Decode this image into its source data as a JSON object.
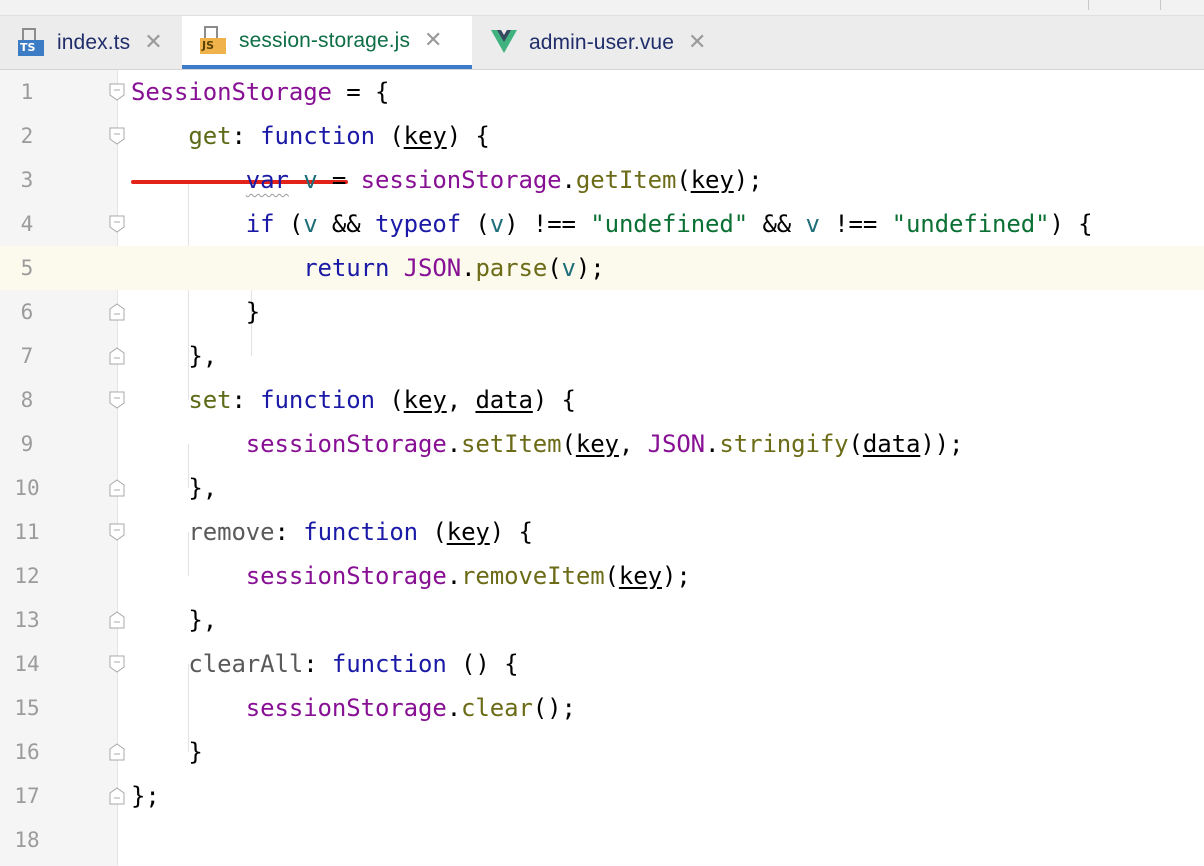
{
  "tabs": [
    {
      "label": "index.ts",
      "badge": "TS",
      "icon": "typescript-file-icon"
    },
    {
      "label": "session-storage.js",
      "badge": "JS",
      "icon": "javascript-file-icon",
      "active": true
    },
    {
      "label": "admin-user.vue",
      "icon": "vue-file-icon"
    }
  ],
  "close_glyph": "✕",
  "line_numbers": [
    "1",
    "2",
    "3",
    "4",
    "5",
    "6",
    "7",
    "8",
    "9",
    "10",
    "11",
    "12",
    "13",
    "14",
    "15",
    "16",
    "17",
    "18"
  ],
  "current_line": 5,
  "code": {
    "l1": {
      "obj": "SessionStorage",
      "rest": " = {"
    },
    "l2": {
      "prop": "get",
      "colon": ": ",
      "kw": "function",
      "sp": " (",
      "p1": "key",
      "end": ") {"
    },
    "l3": {
      "kw": "var",
      "sp": " ",
      "v": "v",
      "eq": " = ",
      "obj": "sessionStorage",
      "dot": ".",
      "m": "getItem",
      "open": "(",
      "p": "key",
      "close": ");"
    },
    "l4": {
      "kw": "if",
      "o1": " (",
      "v1": "v",
      "a1": " && ",
      "kw2": "typeof",
      "o2": " (",
      "v2": "v",
      "o3": ") !== ",
      "s1": "\"undefined\"",
      "a2": " && ",
      "v3": "v",
      "o4": " !== ",
      "s2": "\"undefined\"",
      "end": ") {"
    },
    "l5": {
      "kw": "return",
      "sp": " ",
      "obj": "JSON",
      "dot": ".",
      "m": "parse",
      "open": "(",
      "v": "v",
      "close": ");"
    },
    "l6": {
      "text": "}"
    },
    "l7": {
      "text": "},"
    },
    "l8": {
      "prop": "set",
      "colon": ": ",
      "kw": "function",
      "sp": " (",
      "p1": "key",
      "comma": ", ",
      "p2": "data",
      "end": ") {"
    },
    "l9": {
      "obj": "sessionStorage",
      "dot": ".",
      "m": "setItem",
      "open": "(",
      "p1": "key",
      "comma": ", ",
      "obj2": "JSON",
      "dot2": ".",
      "m2": "stringify",
      "open2": "(",
      "p2": "data",
      "close": "));"
    },
    "l10": {
      "text": "},"
    },
    "l11": {
      "prop": "remove",
      "colon": ": ",
      "kw": "function",
      "sp": " (",
      "p1": "key",
      "end": ") {"
    },
    "l12": {
      "obj": "sessionStorage",
      "dot": ".",
      "m": "removeItem",
      "open": "(",
      "p": "key",
      "close": ");"
    },
    "l13": {
      "text": "},"
    },
    "l14": {
      "prop": "clearAll",
      "colon": ": ",
      "kw": "function",
      "end": " () {"
    },
    "l15": {
      "obj": "sessionStorage",
      "dot": ".",
      "m": "clear",
      "close": "();"
    },
    "l16": {
      "text": "}"
    },
    "l17": {
      "text": "};"
    },
    "l18": {
      "text": ""
    }
  },
  "colors": {
    "keyword": "#1a1aa6",
    "global": "#871094",
    "property": "#5c6b17",
    "string": "#0a7033",
    "local_var": "#1f6f7b",
    "active_tab_underline": "#3d7ccb",
    "current_line_bg": "#fcfaed",
    "annotation_underline": "#e2231a"
  }
}
